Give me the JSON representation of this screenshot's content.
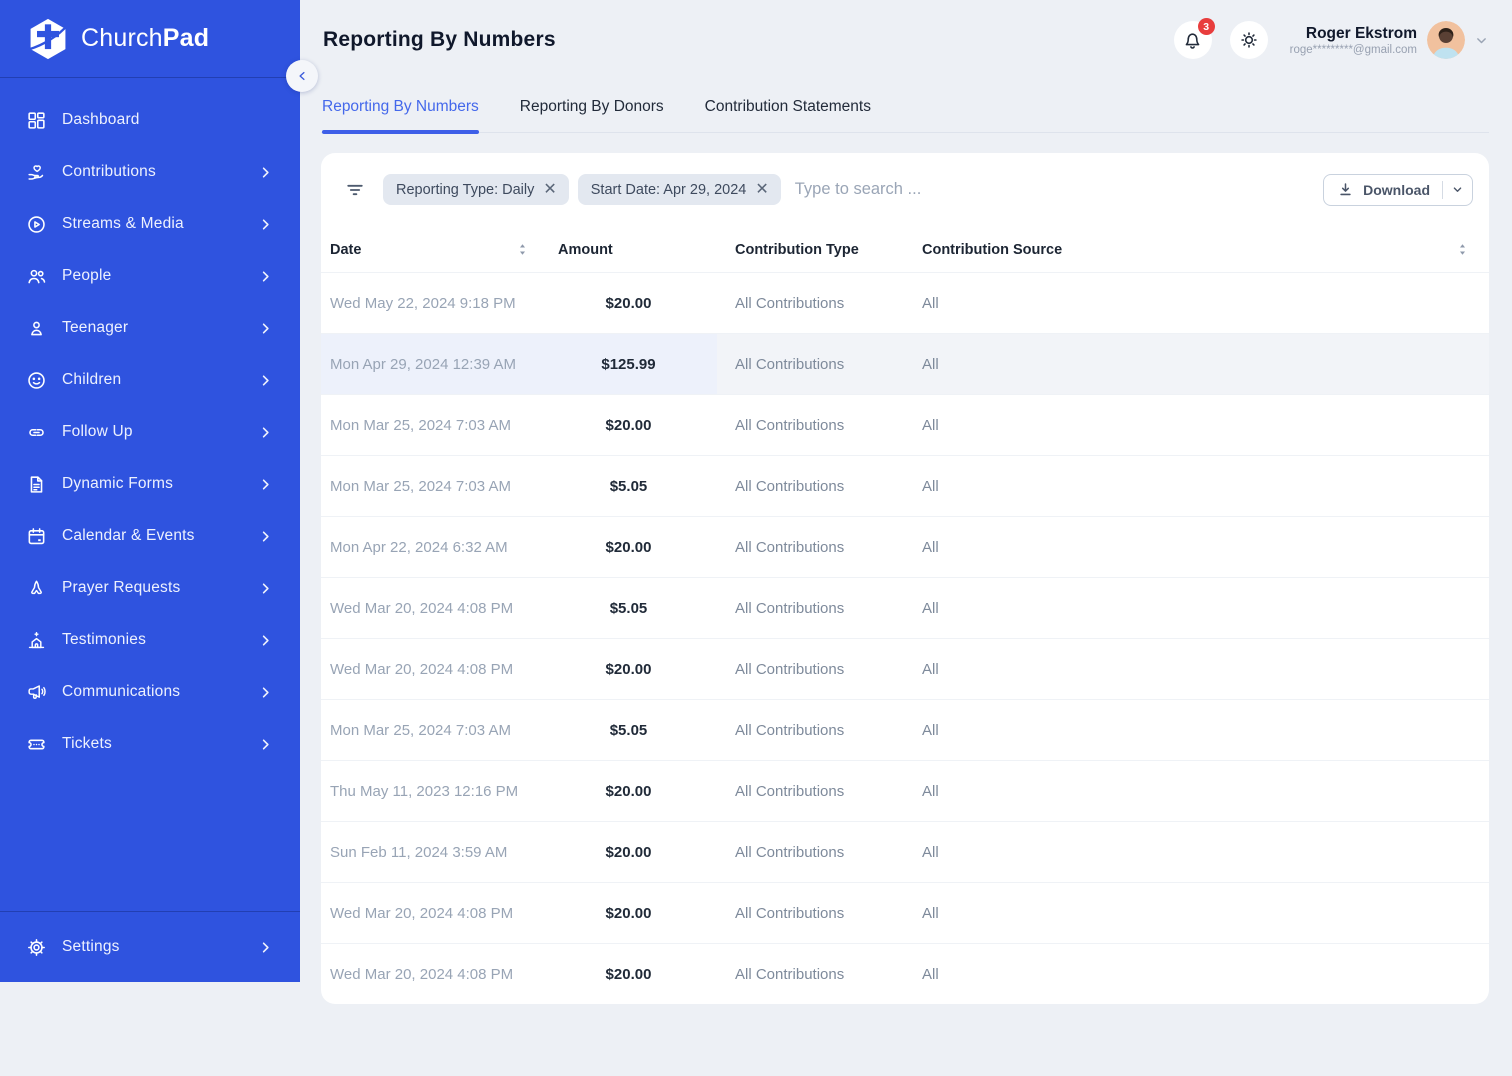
{
  "app": {
    "name_part1": "Church",
    "name_part2": "Pad"
  },
  "colors": {
    "sidebar_blue": "#2F53DF",
    "accent_blue": "#4468EB",
    "badge_red": "#E83D3D",
    "row_highlight": "#EDF1FB"
  },
  "sidebar": {
    "items": [
      {
        "label": "Dashboard",
        "icon": "dashboard-icon",
        "has_chevron": false
      },
      {
        "label": "Contributions",
        "icon": "hand-heart-icon",
        "has_chevron": true
      },
      {
        "label": "Streams & Media",
        "icon": "play-circle-icon",
        "has_chevron": true
      },
      {
        "label": "People",
        "icon": "people-icon",
        "has_chevron": true
      },
      {
        "label": "Teenager",
        "icon": "person-icon",
        "has_chevron": true
      },
      {
        "label": "Children",
        "icon": "child-face-icon",
        "has_chevron": true
      },
      {
        "label": "Follow Up",
        "icon": "link-icon",
        "has_chevron": true
      },
      {
        "label": "Dynamic Forms",
        "icon": "document-icon",
        "has_chevron": true
      },
      {
        "label": "Calendar & Events",
        "icon": "calendar-icon",
        "has_chevron": true
      },
      {
        "label": "Prayer Requests",
        "icon": "praying-hands-icon",
        "has_chevron": true
      },
      {
        "label": "Testimonies",
        "icon": "church-icon",
        "has_chevron": true
      },
      {
        "label": "Communications",
        "icon": "megaphone-icon",
        "has_chevron": true
      },
      {
        "label": "Tickets",
        "icon": "ticket-icon",
        "has_chevron": true
      }
    ],
    "settings_label": "Settings"
  },
  "header": {
    "title": "Reporting By Numbers",
    "notification_count": "3",
    "user": {
      "name": "Roger Ekstrom",
      "email": "roge*********@gmail.com"
    }
  },
  "tabs": [
    {
      "label": "Reporting By Numbers",
      "active": true
    },
    {
      "label": "Reporting By Donors",
      "active": false
    },
    {
      "label": "Contribution Statements",
      "active": false
    }
  ],
  "filters": {
    "chips": [
      {
        "label": "Reporting Type: Daily"
      },
      {
        "label": "Start Date: Apr 29, 2024"
      }
    ],
    "search_placeholder": "Type to search ...",
    "download_label": "Download"
  },
  "table": {
    "columns": [
      "Date",
      "Amount",
      "Contribution Type",
      "Contribution Source"
    ],
    "rows": [
      {
        "date": "Wed May 22, 2024 9:18 PM",
        "amount": "$20.00",
        "type": "All Contributions",
        "source": "All"
      },
      {
        "date": "Mon Apr 29, 2024 12:39 AM",
        "amount": "$125.99",
        "type": "All Contributions",
        "source": "All",
        "highlighted": true
      },
      {
        "date": "Mon Mar 25, 2024 7:03 AM",
        "amount": "$20.00",
        "type": "All Contributions",
        "source": "All"
      },
      {
        "date": "Mon Mar 25, 2024 7:03 AM",
        "amount": "$5.05",
        "type": "All Contributions",
        "source": "All"
      },
      {
        "date": "Mon Apr 22, 2024 6:32 AM",
        "amount": "$20.00",
        "type": "All Contributions",
        "source": "All"
      },
      {
        "date": "Wed Mar 20, 2024 4:08 PM",
        "amount": "$5.05",
        "type": "All Contributions",
        "source": "All"
      },
      {
        "date": "Wed Mar 20, 2024 4:08 PM",
        "amount": "$20.00",
        "type": "All Contributions",
        "source": "All"
      },
      {
        "date": "Mon Mar 25, 2024 7:03 AM",
        "amount": "$5.05",
        "type": "All Contributions",
        "source": "All"
      },
      {
        "date": "Thu May 11, 2023 12:16 PM",
        "amount": "$20.00",
        "type": "All Contributions",
        "source": "All"
      },
      {
        "date": "Sun Feb 11, 2024 3:59 AM",
        "amount": "$20.00",
        "type": "All Contributions",
        "source": "All"
      },
      {
        "date": "Wed Mar 20, 2024 4:08 PM",
        "amount": "$20.00",
        "type": "All Contributions",
        "source": "All"
      },
      {
        "date": "Wed Mar 20, 2024 4:08 PM",
        "amount": "$20.00",
        "type": "All Contributions",
        "source": "All"
      }
    ]
  }
}
